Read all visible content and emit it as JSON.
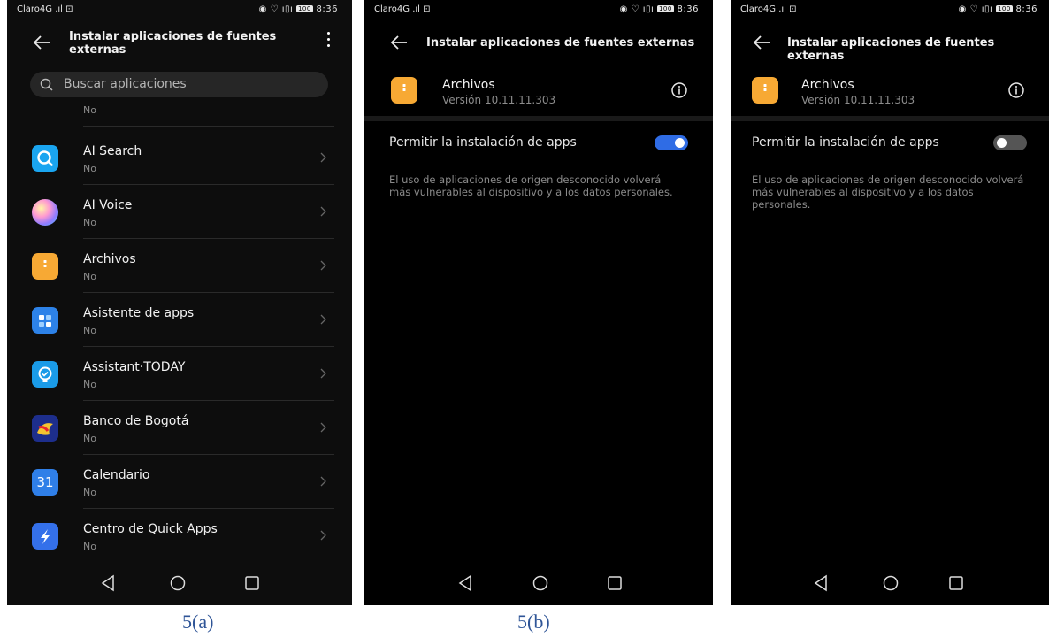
{
  "status_bar": {
    "carrier": "Claro",
    "signal": "4G .ıl",
    "extra": "⊡",
    "icons": "◉ ♡ ı▯ı",
    "battery": "100",
    "time": "8:36"
  },
  "screen_a": {
    "title": "Instalar aplicaciones de fuentes externas",
    "search_placeholder": "Buscar aplicaciones",
    "partial_item": {
      "status": "No",
      "icon": "partial-app-icon"
    },
    "apps": [
      {
        "name": "AI Search",
        "status": "No",
        "icon": "ai-search-icon"
      },
      {
        "name": "AI Voice",
        "status": "No",
        "icon": "ai-voice-icon"
      },
      {
        "name": "Archivos",
        "status": "No",
        "icon": "archivos-icon"
      },
      {
        "name": "Asistente de apps",
        "status": "No",
        "icon": "asistente-icon"
      },
      {
        "name": "Assistant·TODAY",
        "status": "No",
        "icon": "assistant-today-icon"
      },
      {
        "name": "Banco de Bogotá",
        "status": "No",
        "icon": "banco-icon"
      },
      {
        "name": "Calendario",
        "status": "No",
        "icon": "calendar-icon",
        "icon_text": "31"
      },
      {
        "name": "Centro de Quick Apps",
        "status": "No",
        "icon": "quick-apps-icon"
      }
    ]
  },
  "screen_b": {
    "title": "Instalar aplicaciones de fuentes externas",
    "app_name": "Archivos",
    "version": "Versión 10.11.11.303",
    "permission_label": "Permitir la instalación de apps",
    "permission_enabled": true,
    "warning": "El uso de aplicaciones de origen desconocido volverá más vulnerables al dispositivo y a los datos personales."
  },
  "screen_c": {
    "title": "Instalar aplicaciones de fuentes externas",
    "app_name": "Archivos",
    "version": "Versión 10.11.11.303",
    "permission_label": "Permitir la instalación de apps",
    "permission_enabled": false,
    "warning": "El uso de aplicaciones de origen desconocido volverá más vulnerables al dispositivo y a los datos personales."
  },
  "captions": {
    "a": "5(a)",
    "b": "5(b)"
  },
  "colors": {
    "accent": "#2f6ce5",
    "archivos": "#f7a934",
    "caption": "#2f5597"
  }
}
